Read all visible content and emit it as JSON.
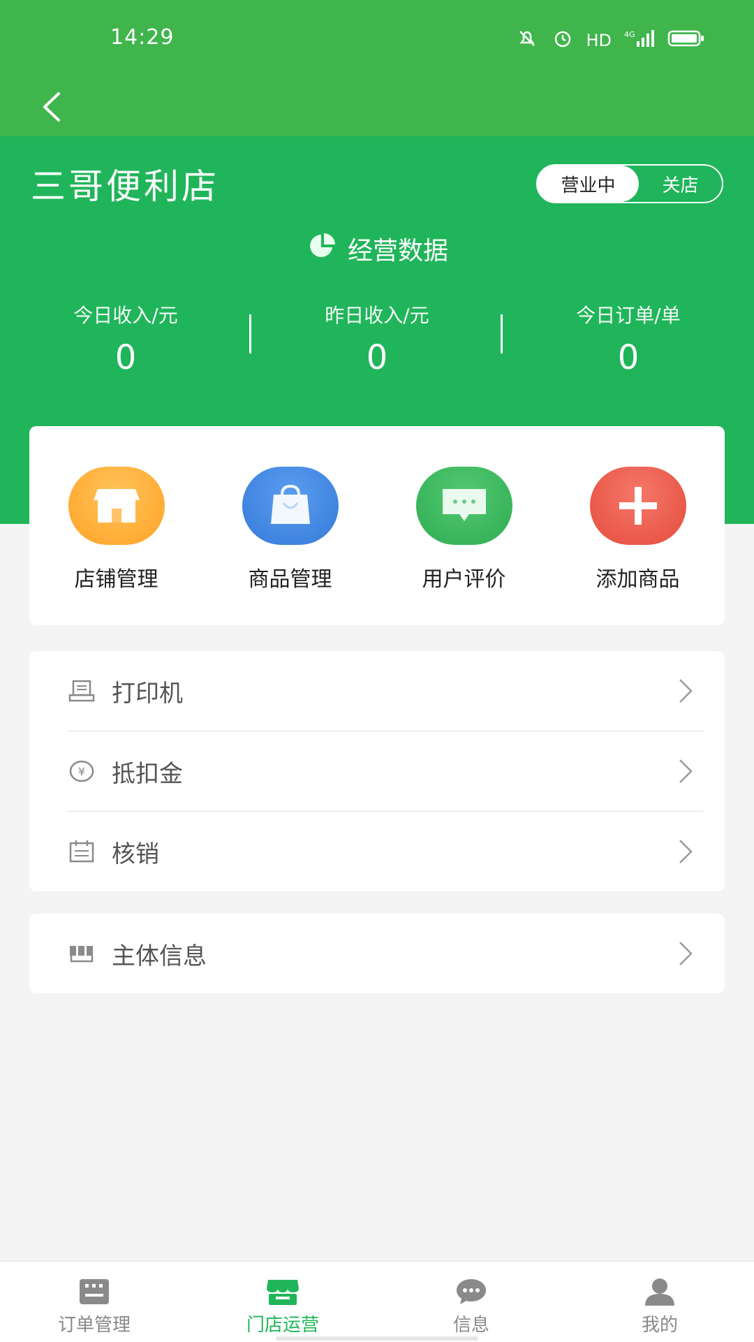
{
  "status": {
    "time": "14:29",
    "network_label": "HD"
  },
  "header": {
    "store_name": "三哥便利店",
    "toggle": {
      "on_label": "营业中",
      "off_label": "关店"
    },
    "section_title": "经营数据",
    "stats": [
      {
        "label": "今日收入/元",
        "value": "0"
      },
      {
        "label": "昨日收入/元",
        "value": "0"
      },
      {
        "label": "今日订单/单",
        "value": "0"
      }
    ]
  },
  "quick": [
    {
      "label": "店铺管理",
      "icon": "store-icon",
      "color": "#ffa72a"
    },
    {
      "label": "商品管理",
      "icon": "shopping-bag-icon",
      "color": "#3f86e6"
    },
    {
      "label": "用户评价",
      "icon": "chat-bubble-icon",
      "color": "#39b85a"
    },
    {
      "label": "添加商品",
      "icon": "plus-icon",
      "color": "#ed5b4b"
    }
  ],
  "menu": [
    {
      "label": "打印机",
      "icon": "printer-icon"
    },
    {
      "label": "抵扣金",
      "icon": "yuan-coin-icon"
    },
    {
      "label": "核销",
      "icon": "calendar-icon"
    }
  ],
  "menu2": [
    {
      "label": "主体信息",
      "icon": "store-front-icon"
    }
  ],
  "tabs": [
    {
      "label": "订单管理",
      "icon": "orders-icon",
      "active": false
    },
    {
      "label": "门店运营",
      "icon": "store-icon",
      "active": true
    },
    {
      "label": "信息",
      "icon": "message-icon",
      "active": false
    },
    {
      "label": "我的",
      "icon": "user-icon",
      "active": false
    }
  ],
  "colors": {
    "primary": "#20b55a",
    "status_bar": "#3fb54c"
  }
}
